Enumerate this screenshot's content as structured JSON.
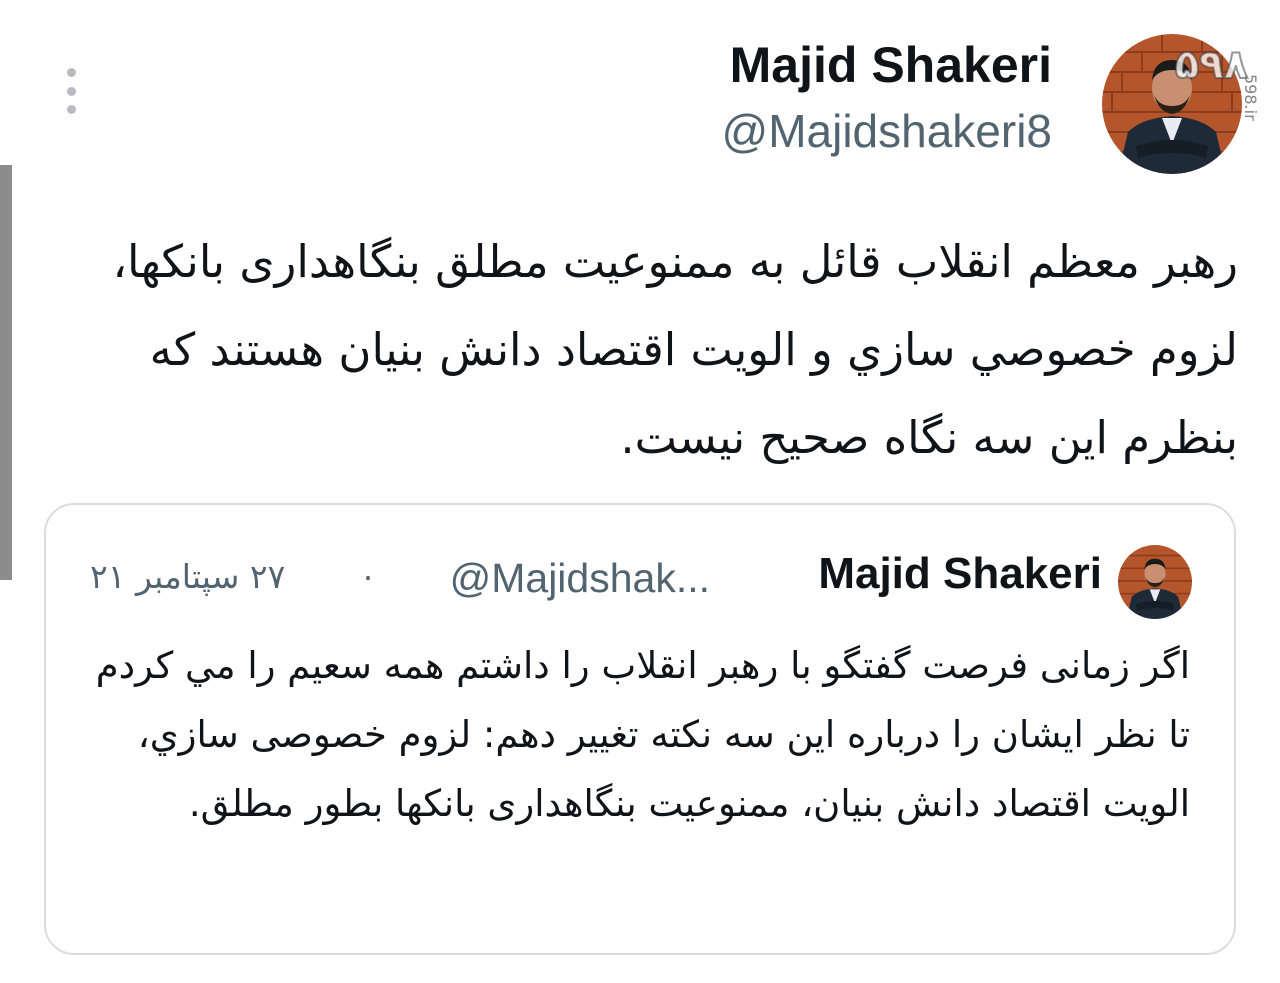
{
  "tweet": {
    "author_name": "Majid Shakeri",
    "author_handle": "@Majidshakeri8",
    "text": "رهبر معظم انقلاب قائل به ممنوعیت مطلق بنگاهداری بانکها، لزوم خصوصي سازي و الويت اقتصاد دانش بنیان هستند که بنظرم این سه نگاه صحیح نیست.",
    "avatar_icon": "profile-photo",
    "menu_icon": "more-vertical-icon"
  },
  "quoted_tweet": {
    "author_name": "Majid Shakeri",
    "author_handle": "@Majidshak...",
    "separator": "·",
    "date": "۲۷ سپتامبر ۲۱",
    "text": "اگر زمانی فرصت گفتگو با رهبر انقلاب را داشتم همه سعیم را مي کردم تا نظر ایشان را درباره این سه نکته تغییر دهم: لزوم خصوصی سازي، الويت اقتصاد دانش بنیان، ممنوعیت بنگاهداری بانکها بطور مطلق."
  },
  "watermark": {
    "logo": "۵۹۸",
    "site": "598.ir"
  },
  "colors": {
    "text_primary": "#0f1419",
    "text_secondary": "#536471",
    "border": "#d9dde1",
    "avatar_bg": "#b4552c"
  }
}
